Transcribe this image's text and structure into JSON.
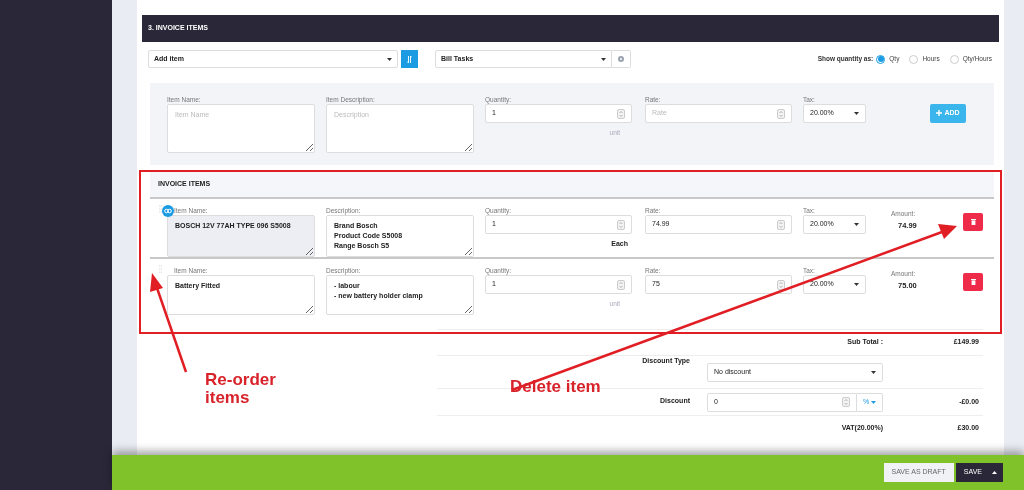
{
  "section_title": "3. INVOICE ITEMS",
  "toolbar": {
    "add_item_select": "Add item",
    "bill_tasks_select": "Bill Tasks",
    "quantity_label": "Show quantity as:",
    "quantity_options": [
      {
        "label": "Qty",
        "selected": true
      },
      {
        "label": "Hours",
        "selected": false
      },
      {
        "label": "Qty/Hours",
        "selected": false
      }
    ]
  },
  "new_item": {
    "name_label": "Item Name:",
    "name_placeholder": "Item Name",
    "description_label": "Item Description:",
    "description_placeholder": "Description",
    "quantity_label": "Quantity:",
    "quantity": "1",
    "unit_placeholder": "unit",
    "rate_label": "Rate:",
    "rate_placeholder": "Rate",
    "tax_label": "Tax:",
    "tax": "20.00%",
    "add_button": "ADD"
  },
  "invoice_items": {
    "title": "INVOICE ITEMS",
    "rows": [
      {
        "linked": true,
        "name_label": "Item Name:",
        "name": "BOSCH 12V 77AH TYPE 096 S5008",
        "description_label": "Description:",
        "description": "Brand Bosch\nProduct Code S5008\nRange Bosch S5",
        "quantity_label": "Quantity:",
        "quantity": "1",
        "unit": "Each",
        "rate_label": "Rate:",
        "rate": "74.99",
        "tax_label": "Tax:",
        "tax": "20.00%",
        "amount_label": "Amount:",
        "amount": "74.99"
      },
      {
        "linked": false,
        "name_label": "Item Name:",
        "name": "Battery Fitted",
        "description_label": "Description:",
        "description": "- labour\n- new battery holder clamp",
        "quantity_label": "Quantity:",
        "quantity": "1",
        "unit_placeholder": "unit",
        "rate_label": "Rate:",
        "rate": "75",
        "tax_label": "Tax:",
        "tax": "20.00%",
        "amount_label": "Amount:",
        "amount": "75.00"
      }
    ]
  },
  "totals": [
    {
      "kind": "text",
      "label": "Sub Total :",
      "amount": "£149.99"
    },
    {
      "kind": "select",
      "label": "Discount Type",
      "value": "No discount"
    },
    {
      "kind": "number",
      "label": "Discount",
      "value": "0",
      "unit": "%",
      "amount": "-£0.00"
    },
    {
      "kind": "text",
      "label": "VAT(20.00%)",
      "amount": "£30.00"
    }
  ],
  "annotations": [
    {
      "kind": "reorder",
      "text": "Re-order items"
    },
    {
      "kind": "delete",
      "text": "Delete item"
    }
  ],
  "footer": {
    "draft_button": "SAVE AS DRAFT",
    "save_button": "SAVE"
  }
}
